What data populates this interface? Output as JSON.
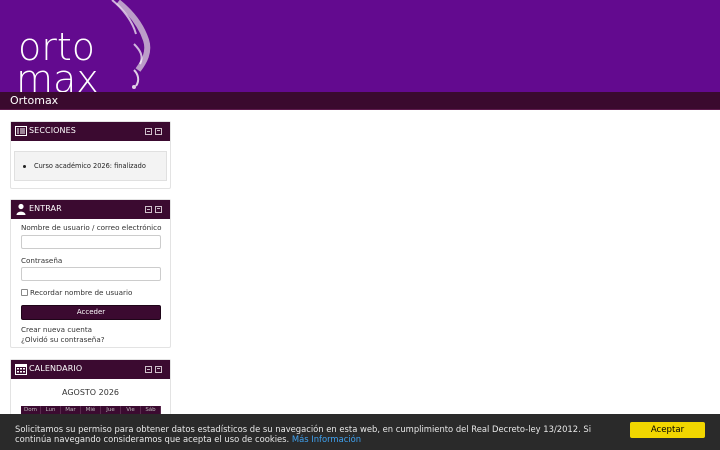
{
  "header": {
    "logo_line1": "orto",
    "logo_line2": "max"
  },
  "navbar": {
    "brand": "Ortomax"
  },
  "blocks": {
    "secciones": {
      "title": "SECCIONES",
      "icon": "list-icon",
      "items": [
        "Curso académico 2026: finalizado"
      ]
    },
    "entrar": {
      "title": "ENTRAR",
      "icon": "user-icon",
      "username_label": "Nombre de usuario / correo electrónico",
      "username_value": "",
      "password_label": "Contraseña",
      "password_value": "",
      "remember_label": "Recordar nombre de usuario",
      "login_button": "Acceder",
      "create_account": "Crear nueva cuenta",
      "forgot_password": "¿Olvidó su contraseña?"
    },
    "calendario": {
      "title": "CALENDARIO",
      "icon": "calendar-icon",
      "month": "AGOSTO 2026",
      "weekdays": [
        "Dom",
        "Lun",
        "Mar",
        "Mié",
        "Jue",
        "Vie",
        "Sáb"
      ]
    }
  },
  "cookie": {
    "message": "Solicitamos su permiso para obtener datos estadísticos de su navegación en esta web, en cumplimiento del Real Decreto-ley 13/2012. Si continúa navegando consideramos que acepta el uso de cookies.",
    "more_link": "Más Información",
    "accept_button": "Aceptar"
  },
  "colors": {
    "header_bg": "#630a8f",
    "navbar_bg": "#3a0a2e",
    "block_header_bg": "#3b0a30",
    "cookie_bg": "#2a2a2a",
    "accept_bg": "#f1d600",
    "link": "#3fa1ef"
  }
}
